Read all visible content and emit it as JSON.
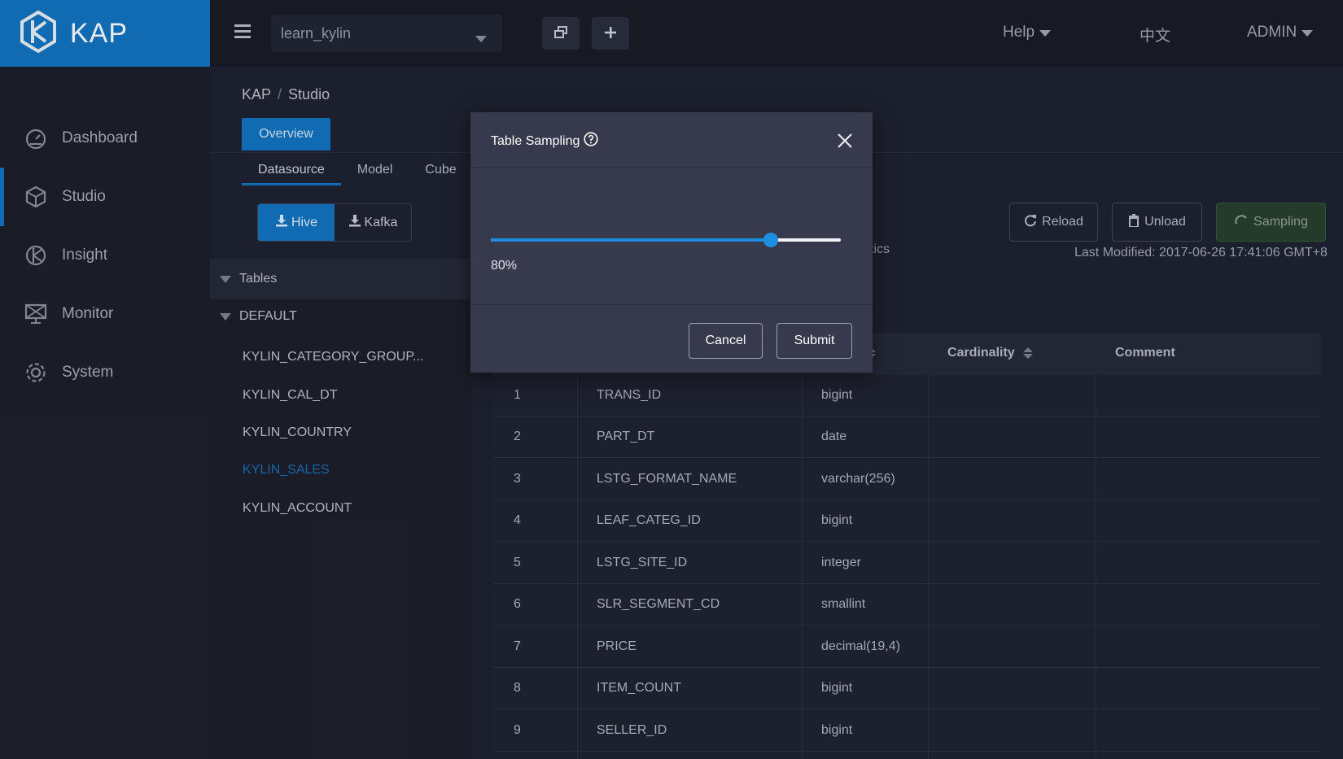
{
  "header": {
    "brand": "KAP",
    "project": "learn_kylin",
    "help_label": "Help",
    "lang_label": "中文",
    "user_label": "ADMIN"
  },
  "sidebar": {
    "items": [
      {
        "label": "Dashboard",
        "icon": "dashboard-icon"
      },
      {
        "label": "Studio",
        "icon": "studio-icon"
      },
      {
        "label": "Insight",
        "icon": "insight-icon"
      },
      {
        "label": "Monitor",
        "icon": "monitor-icon"
      },
      {
        "label": "System",
        "icon": "system-icon"
      }
    ],
    "active": "Studio"
  },
  "breadcrumb": [
    "KAP",
    "Studio"
  ],
  "main_tab": "Overview",
  "subtabs": [
    "Datasource",
    "Model",
    "Cube"
  ],
  "source_buttons": [
    "Hive",
    "Kafka"
  ],
  "tree": {
    "header": "Tables",
    "database": "DEFAULT",
    "tables": [
      "KYLIN_CATEGORY_GROUP...",
      "KYLIN_CAL_DT",
      "KYLIN_COUNTRY",
      "KYLIN_SALES",
      "KYLIN_ACCOUNT"
    ],
    "selected": "KYLIN_SALES"
  },
  "actions": {
    "reload": "Reload",
    "unload": "Unload",
    "sampling": "Sampling",
    "last_modified": "Last Modified: 2017-06-26 17:41:06 GMT+8",
    "statistics_fragment": "tics"
  },
  "table": {
    "headers": {
      "type_fragment": "e",
      "cardinality": "Cardinality",
      "comment": "Comment"
    },
    "rows": [
      {
        "id": "1",
        "name": "TRANS_ID",
        "type": "bigint"
      },
      {
        "id": "2",
        "name": "PART_DT",
        "type": "date"
      },
      {
        "id": "3",
        "name": "LSTG_FORMAT_NAME",
        "type": "varchar(256)"
      },
      {
        "id": "4",
        "name": "LEAF_CATEG_ID",
        "type": "bigint"
      },
      {
        "id": "5",
        "name": "LSTG_SITE_ID",
        "type": "integer"
      },
      {
        "id": "6",
        "name": "SLR_SEGMENT_CD",
        "type": "smallint"
      },
      {
        "id": "7",
        "name": "PRICE",
        "type": "decimal(19,4)"
      },
      {
        "id": "8",
        "name": "ITEM_COUNT",
        "type": "bigint"
      },
      {
        "id": "9",
        "name": "SELLER_ID",
        "type": "bigint"
      }
    ]
  },
  "modal": {
    "title": "Table Sampling",
    "slider_percent": 80,
    "slider_label": "80%",
    "cancel_label": "Cancel",
    "submit_label": "Submit"
  },
  "colors": {
    "brand": "#1275c2",
    "slider": "#1d8fe0",
    "selected_table": "#1a6fb6",
    "sampling_bg": "#28402f"
  }
}
